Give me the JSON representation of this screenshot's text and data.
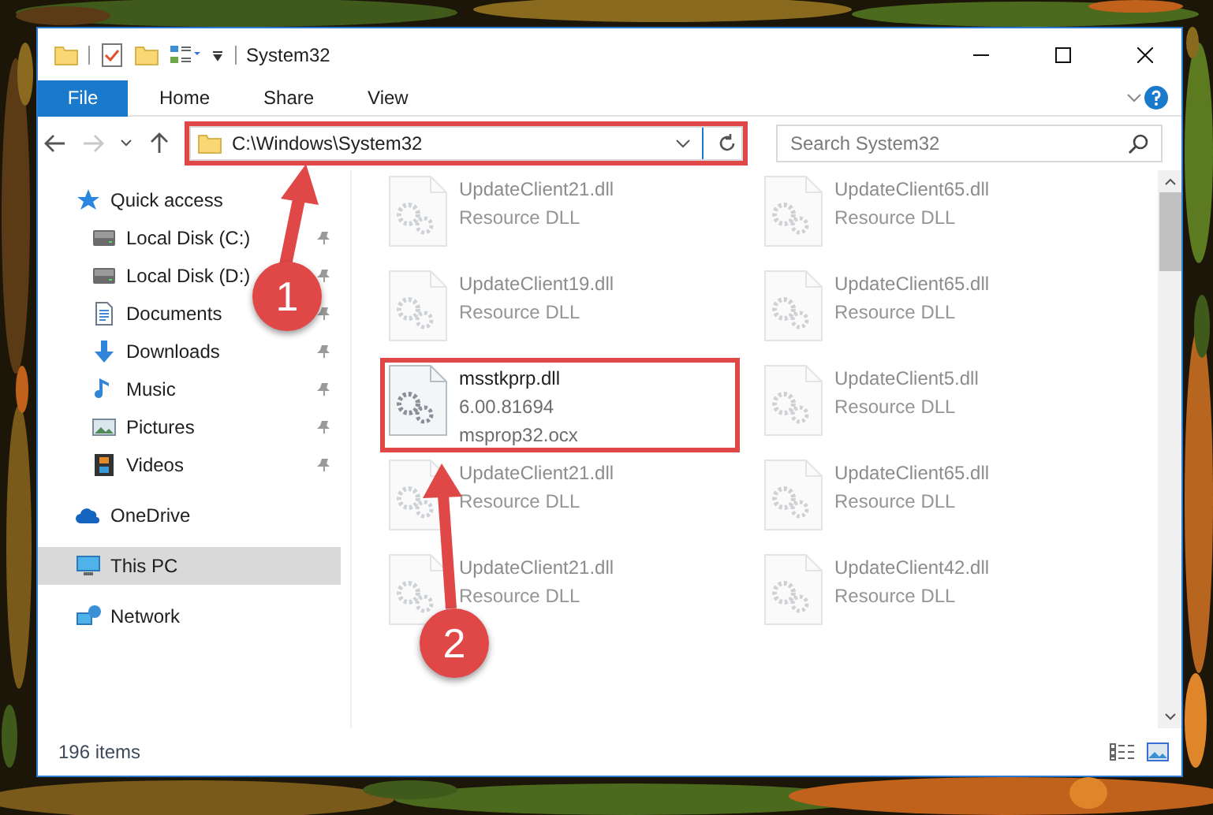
{
  "window": {
    "title": "System32"
  },
  "ribbon": {
    "tabs": [
      {
        "label": "File",
        "kind": "file"
      },
      {
        "label": "Home",
        "kind": "tab"
      },
      {
        "label": "Share",
        "kind": "tab"
      },
      {
        "label": "View",
        "kind": "tab"
      }
    ]
  },
  "address_bar": {
    "path": "C:\\Windows\\System32",
    "highlighted": true
  },
  "search": {
    "placeholder": "Search System32"
  },
  "sidebar": {
    "items": [
      {
        "label": "Quick access",
        "selected": false,
        "children": [
          {
            "label": "Local Disk (C:)",
            "selected": false,
            "pinned": true
          },
          {
            "label": "Local Disk (D:)",
            "selected": false,
            "pinned": true
          },
          {
            "label": "Documents",
            "selected": false,
            "pinned": true
          },
          {
            "label": "Downloads",
            "selected": false,
            "pinned": true
          },
          {
            "label": "Music",
            "selected": false,
            "pinned": true
          },
          {
            "label": "Pictures",
            "selected": false,
            "pinned": true
          },
          {
            "label": "Videos",
            "selected": false,
            "pinned": true
          }
        ]
      },
      {
        "label": "OneDrive",
        "selected": false
      },
      {
        "label": "This PC",
        "selected": true
      },
      {
        "label": "Network",
        "selected": false
      }
    ]
  },
  "files": [
    {
      "name": "UpdateClient21.dll",
      "details": [
        "Resource DLL"
      ],
      "blurred": true,
      "highlighted": false
    },
    {
      "name": "UpdateClient65.dll",
      "details": [
        "Resource DLL"
      ],
      "blurred": true,
      "highlighted": false
    },
    {
      "name": "UpdateClient19.dll",
      "details": [
        "Resource DLL"
      ],
      "blurred": true,
      "highlighted": false
    },
    {
      "name": "UpdateClient65.dll",
      "details": [
        "Resource DLL"
      ],
      "blurred": true,
      "highlighted": false
    },
    {
      "name": "msstkprp.dll",
      "details": [
        "6.00.81694",
        "msprop32.ocx"
      ],
      "blurred": false,
      "highlighted": true
    },
    {
      "name": "UpdateClient5.dll",
      "details": [
        "Resource DLL"
      ],
      "blurred": true,
      "highlighted": false
    },
    {
      "name": "UpdateClient21.dll",
      "details": [
        "Resource DLL"
      ],
      "blurred": true,
      "highlighted": false
    },
    {
      "name": "UpdateClient65.dll",
      "details": [
        "Resource DLL"
      ],
      "blurred": true,
      "highlighted": false
    },
    {
      "name": "UpdateClient21.dll",
      "details": [
        "Resource DLL"
      ],
      "blurred": true,
      "highlighted": false
    },
    {
      "name": "UpdateClient42.dll",
      "details": [
        "Resource DLL"
      ],
      "blurred": true,
      "highlighted": false
    }
  ],
  "status_bar": {
    "item_count": "196 items"
  },
  "annotations": [
    {
      "label": "1"
    },
    {
      "label": "2"
    }
  ]
}
